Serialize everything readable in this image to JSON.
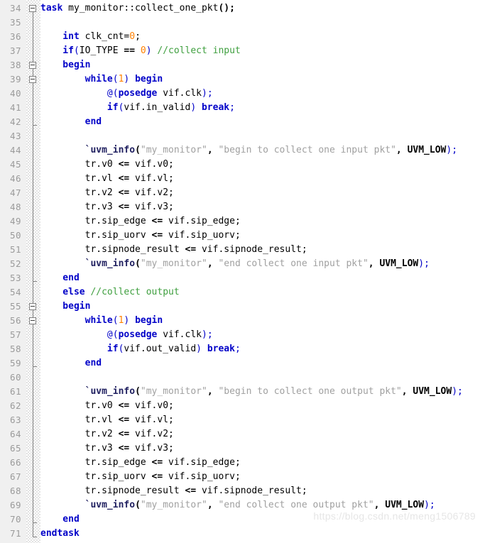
{
  "editor": {
    "language": "SystemVerilog",
    "first_line": 34,
    "last_line": 71,
    "line_height": 20,
    "colors": {
      "background": "#ffffff",
      "gutter_background": "#f0f0f0",
      "line_number": "#9a9a9a",
      "keyword": "#0000c8",
      "number": "#ff8000",
      "comment": "#3f9f3f",
      "string": "#a0a0a0",
      "macro": "#202060",
      "identifier": "#000000",
      "fold_line": "#808080",
      "watermark": "#e6e6e6"
    }
  },
  "watermark": {
    "text": "https://blog.csdn.net/meng1506789"
  },
  "lines": [
    {
      "number": "34",
      "fold": "open",
      "tokens": [
        {
          "t": "task",
          "c": "kw"
        },
        {
          "t": " my_monitor::collect_one_pkt",
          "c": "ident"
        },
        {
          "t": "();",
          "c": "bold"
        }
      ]
    },
    {
      "number": "35",
      "fold": "none",
      "tokens": []
    },
    {
      "number": "36",
      "fold": "none",
      "tokens": [
        {
          "t": "    int",
          "c": "kw"
        },
        {
          "t": " clk_cnt=",
          "c": "ident"
        },
        {
          "t": "0",
          "c": "num"
        },
        {
          "t": ";",
          "c": "ident"
        }
      ]
    },
    {
      "number": "37",
      "fold": "none",
      "tokens": [
        {
          "t": "    if",
          "c": "kw"
        },
        {
          "t": "(",
          "c": "punc-b"
        },
        {
          "t": "IO_TYPE ",
          "c": "ident"
        },
        {
          "t": "==",
          "c": "bold"
        },
        {
          "t": " ",
          "c": "ident"
        },
        {
          "t": "0",
          "c": "num"
        },
        {
          "t": ")",
          "c": "punc-b"
        },
        {
          "t": " ",
          "c": "ident"
        },
        {
          "t": "//collect input",
          "c": "cmt"
        }
      ]
    },
    {
      "number": "38",
      "fold": "open",
      "tokens": [
        {
          "t": "    begin",
          "c": "kw"
        }
      ]
    },
    {
      "number": "39",
      "fold": "open",
      "tokens": [
        {
          "t": "        while",
          "c": "kw"
        },
        {
          "t": "(",
          "c": "punc-b"
        },
        {
          "t": "1",
          "c": "num"
        },
        {
          "t": ")",
          "c": "punc-b"
        },
        {
          "t": " ",
          "c": "ident"
        },
        {
          "t": "begin",
          "c": "kw"
        }
      ]
    },
    {
      "number": "40",
      "fold": "none",
      "tokens": [
        {
          "t": "            @(",
          "c": "punc-b"
        },
        {
          "t": "posedge",
          "c": "kw"
        },
        {
          "t": " vif.clk",
          "c": "ident"
        },
        {
          "t": ");",
          "c": "punc-b"
        }
      ]
    },
    {
      "number": "41",
      "fold": "none",
      "tokens": [
        {
          "t": "            if",
          "c": "kw"
        },
        {
          "t": "(",
          "c": "punc-b"
        },
        {
          "t": "vif.in_valid",
          "c": "ident"
        },
        {
          "t": ")",
          "c": "punc-b"
        },
        {
          "t": " ",
          "c": "ident"
        },
        {
          "t": "break",
          "c": "kw"
        },
        {
          "t": ";",
          "c": "punc-b"
        }
      ]
    },
    {
      "number": "42",
      "fold": "end",
      "tokens": [
        {
          "t": "        end",
          "c": "kw"
        }
      ]
    },
    {
      "number": "43",
      "fold": "none",
      "tokens": []
    },
    {
      "number": "44",
      "fold": "none",
      "tokens": [
        {
          "t": "        `uvm_info",
          "c": "mac"
        },
        {
          "t": "(",
          "c": "bold"
        },
        {
          "t": "\"my_monitor\"",
          "c": "str"
        },
        {
          "t": ", ",
          "c": "bold"
        },
        {
          "t": "\"begin to collect one input pkt\"",
          "c": "str"
        },
        {
          "t": ", ",
          "c": "bold"
        },
        {
          "t": "UVM_LOW",
          "c": "bold"
        },
        {
          "t": ");",
          "c": "punc-b"
        }
      ]
    },
    {
      "number": "45",
      "fold": "none",
      "tokens": [
        {
          "t": "        tr.v0 ",
          "c": "ident"
        },
        {
          "t": "<=",
          "c": "bold"
        },
        {
          "t": " vif.v0;",
          "c": "ident"
        }
      ]
    },
    {
      "number": "46",
      "fold": "none",
      "tokens": [
        {
          "t": "        tr.vl ",
          "c": "ident"
        },
        {
          "t": "<=",
          "c": "bold"
        },
        {
          "t": " vif.vl;",
          "c": "ident"
        }
      ]
    },
    {
      "number": "47",
      "fold": "none",
      "tokens": [
        {
          "t": "        tr.v2 ",
          "c": "ident"
        },
        {
          "t": "<=",
          "c": "bold"
        },
        {
          "t": " vif.v2;",
          "c": "ident"
        }
      ]
    },
    {
      "number": "48",
      "fold": "none",
      "tokens": [
        {
          "t": "        tr.v3 ",
          "c": "ident"
        },
        {
          "t": "<=",
          "c": "bold"
        },
        {
          "t": " vif.v3;",
          "c": "ident"
        }
      ]
    },
    {
      "number": "49",
      "fold": "none",
      "tokens": [
        {
          "t": "        tr.sip_edge ",
          "c": "ident"
        },
        {
          "t": "<=",
          "c": "bold"
        },
        {
          "t": " vif.sip_edge;",
          "c": "ident"
        }
      ]
    },
    {
      "number": "50",
      "fold": "none",
      "tokens": [
        {
          "t": "        tr.sip_uorv ",
          "c": "ident"
        },
        {
          "t": "<=",
          "c": "bold"
        },
        {
          "t": " vif.sip_uorv;",
          "c": "ident"
        }
      ]
    },
    {
      "number": "51",
      "fold": "none",
      "tokens": [
        {
          "t": "        tr.sipnode_result ",
          "c": "ident"
        },
        {
          "t": "<=",
          "c": "bold"
        },
        {
          "t": " vif.sipnode_result;",
          "c": "ident"
        }
      ]
    },
    {
      "number": "52",
      "fold": "none",
      "tokens": [
        {
          "t": "        `uvm_info",
          "c": "mac"
        },
        {
          "t": "(",
          "c": "bold"
        },
        {
          "t": "\"my_monitor\"",
          "c": "str"
        },
        {
          "t": ", ",
          "c": "bold"
        },
        {
          "t": "\"end collect one input pkt\"",
          "c": "str"
        },
        {
          "t": ", ",
          "c": "bold"
        },
        {
          "t": "UVM_LOW",
          "c": "bold"
        },
        {
          "t": ");",
          "c": "punc-b"
        }
      ]
    },
    {
      "number": "53",
      "fold": "end",
      "tokens": [
        {
          "t": "    end",
          "c": "kw"
        }
      ]
    },
    {
      "number": "54",
      "fold": "none",
      "tokens": [
        {
          "t": "    else",
          "c": "kw"
        },
        {
          "t": " ",
          "c": "ident"
        },
        {
          "t": "//collect output",
          "c": "cmt"
        }
      ]
    },
    {
      "number": "55",
      "fold": "open",
      "tokens": [
        {
          "t": "    begin",
          "c": "kw"
        }
      ]
    },
    {
      "number": "56",
      "fold": "open",
      "tokens": [
        {
          "t": "        while",
          "c": "kw"
        },
        {
          "t": "(",
          "c": "punc-b"
        },
        {
          "t": "1",
          "c": "num"
        },
        {
          "t": ")",
          "c": "punc-b"
        },
        {
          "t": " ",
          "c": "ident"
        },
        {
          "t": "begin",
          "c": "kw"
        }
      ]
    },
    {
      "number": "57",
      "fold": "none",
      "tokens": [
        {
          "t": "            @(",
          "c": "punc-b"
        },
        {
          "t": "posedge",
          "c": "kw"
        },
        {
          "t": " vif.clk",
          "c": "ident"
        },
        {
          "t": ");",
          "c": "punc-b"
        }
      ]
    },
    {
      "number": "58",
      "fold": "none",
      "tokens": [
        {
          "t": "            if",
          "c": "kw"
        },
        {
          "t": "(",
          "c": "punc-b"
        },
        {
          "t": "vif.out_valid",
          "c": "ident"
        },
        {
          "t": ")",
          "c": "punc-b"
        },
        {
          "t": " ",
          "c": "ident"
        },
        {
          "t": "break",
          "c": "kw"
        },
        {
          "t": ";",
          "c": "punc-b"
        }
      ]
    },
    {
      "number": "59",
      "fold": "end",
      "tokens": [
        {
          "t": "        end",
          "c": "kw"
        }
      ]
    },
    {
      "number": "60",
      "fold": "none",
      "tokens": []
    },
    {
      "number": "61",
      "fold": "none",
      "tokens": [
        {
          "t": "        `uvm_info",
          "c": "mac"
        },
        {
          "t": "(",
          "c": "bold"
        },
        {
          "t": "\"my_monitor\"",
          "c": "str"
        },
        {
          "t": ", ",
          "c": "bold"
        },
        {
          "t": "\"begin to collect one output pkt\"",
          "c": "str"
        },
        {
          "t": ", ",
          "c": "bold"
        },
        {
          "t": "UVM_LOW",
          "c": "bold"
        },
        {
          "t": ");",
          "c": "punc-b"
        }
      ]
    },
    {
      "number": "62",
      "fold": "none",
      "tokens": [
        {
          "t": "        tr.v0 ",
          "c": "ident"
        },
        {
          "t": "<=",
          "c": "bold"
        },
        {
          "t": " vif.v0;",
          "c": "ident"
        }
      ]
    },
    {
      "number": "63",
      "fold": "none",
      "tokens": [
        {
          "t": "        tr.vl ",
          "c": "ident"
        },
        {
          "t": "<=",
          "c": "bold"
        },
        {
          "t": " vif.vl;",
          "c": "ident"
        }
      ]
    },
    {
      "number": "64",
      "fold": "none",
      "tokens": [
        {
          "t": "        tr.v2 ",
          "c": "ident"
        },
        {
          "t": "<=",
          "c": "bold"
        },
        {
          "t": " vif.v2;",
          "c": "ident"
        }
      ]
    },
    {
      "number": "65",
      "fold": "none",
      "tokens": [
        {
          "t": "        tr.v3 ",
          "c": "ident"
        },
        {
          "t": "<=",
          "c": "bold"
        },
        {
          "t": " vif.v3;",
          "c": "ident"
        }
      ]
    },
    {
      "number": "66",
      "fold": "none",
      "tokens": [
        {
          "t": "        tr.sip_edge ",
          "c": "ident"
        },
        {
          "t": "<=",
          "c": "bold"
        },
        {
          "t": " vif.sip_edge;",
          "c": "ident"
        }
      ]
    },
    {
      "number": "67",
      "fold": "none",
      "tokens": [
        {
          "t": "        tr.sip_uorv ",
          "c": "ident"
        },
        {
          "t": "<=",
          "c": "bold"
        },
        {
          "t": " vif.sip_uorv;",
          "c": "ident"
        }
      ]
    },
    {
      "number": "68",
      "fold": "none",
      "tokens": [
        {
          "t": "        tr.sipnode_result ",
          "c": "ident"
        },
        {
          "t": "<=",
          "c": "bold"
        },
        {
          "t": " vif.sipnode_result;",
          "c": "ident"
        }
      ]
    },
    {
      "number": "69",
      "fold": "none",
      "tokens": [
        {
          "t": "        `uvm_info",
          "c": "mac"
        },
        {
          "t": "(",
          "c": "bold"
        },
        {
          "t": "\"my_monitor\"",
          "c": "str"
        },
        {
          "t": ", ",
          "c": "bold"
        },
        {
          "t": "\"end collect one output pkt\"",
          "c": "str"
        },
        {
          "t": ", ",
          "c": "bold"
        },
        {
          "t": "UVM_LOW",
          "c": "bold"
        },
        {
          "t": ");",
          "c": "punc-b"
        }
      ]
    },
    {
      "number": "70",
      "fold": "end",
      "tokens": [
        {
          "t": "    end",
          "c": "kw"
        }
      ]
    },
    {
      "number": "71",
      "fold": "end",
      "tokens": [
        {
          "t": "endtask",
          "c": "kw"
        }
      ]
    }
  ]
}
